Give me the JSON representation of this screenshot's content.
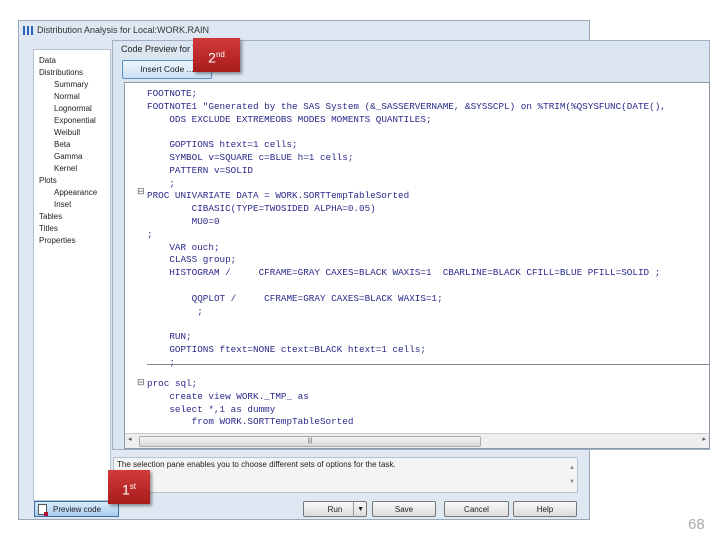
{
  "window": {
    "title": "Distribution Analysis for Local:WORK.RAIN"
  },
  "sidebar": {
    "items": [
      {
        "label": "Data",
        "sub": false
      },
      {
        "label": "Distributions",
        "sub": false
      },
      {
        "label": "Summary",
        "sub": true
      },
      {
        "label": "Normal",
        "sub": true
      },
      {
        "label": "Lognormal",
        "sub": true
      },
      {
        "label": "Exponential",
        "sub": true
      },
      {
        "label": "Weibull",
        "sub": true
      },
      {
        "label": "Beta",
        "sub": true
      },
      {
        "label": "Gamma",
        "sub": true
      },
      {
        "label": "Kernel",
        "sub": true
      },
      {
        "label": "Plots",
        "sub": false
      },
      {
        "label": "Appearance",
        "sub": true
      },
      {
        "label": "Inset",
        "sub": true
      },
      {
        "label": "Tables",
        "sub": false
      },
      {
        "label": "Titles",
        "sub": false
      },
      {
        "label": "Properties",
        "sub": false
      }
    ]
  },
  "preview": {
    "header": "Code Preview for T",
    "insert_code": "Insert Code ...",
    "code_top": "FOOTNOTE;\nFOOTNOTE1 \"Generated by the SAS System (&_SASSERVERNAME, &SYSSCPL) on %TRIM(%QSYSFUNC(DATE(),\n    ODS EXCLUDE EXTREMEOBS MODES MOMENTS QUANTILES;\n\n    GOPTIONS htext=1 cells;\n    SYMBOL v=SQUARE c=BLUE h=1 cells;\n    PATTERN v=SOLID\n    ;\nPROC UNIVARIATE DATA = WORK.SORTTempTableSorted\n        CIBASIC(TYPE=TWOSIDED ALPHA=0.05)\n        MU0=0\n;\n    VAR ouch;\n    CLASS group;\n    HISTOGRAM /     CFRAME=GRAY CAXES=BLACK WAXIS=1  CBARLINE=BLACK CFILL=BLUE PFILL=SOLID ;\n\n        QQPLOT /     CFRAME=GRAY CAXES=BLACK WAXIS=1;\n         ;\n\n    RUN;\n    GOPTIONS ftext=NONE ctext=BLACK htext=1 cells;\n    ;",
    "code_bottom": "proc sql;\n    create view WORK._TMP_ as\n    select *,1 as dummy\n        from WORK.SORTTempTableSorted"
  },
  "description": "The selection pane enables you to choose different sets of options for the task.",
  "buttons": {
    "preview_code": "Preview code",
    "run": "Run",
    "save": "Save",
    "cancel": "Cancel",
    "help": "Help"
  },
  "callouts": {
    "first": "1",
    "first_sup": "st",
    "second": "2",
    "second_sup": "nd"
  },
  "page_number": "68"
}
